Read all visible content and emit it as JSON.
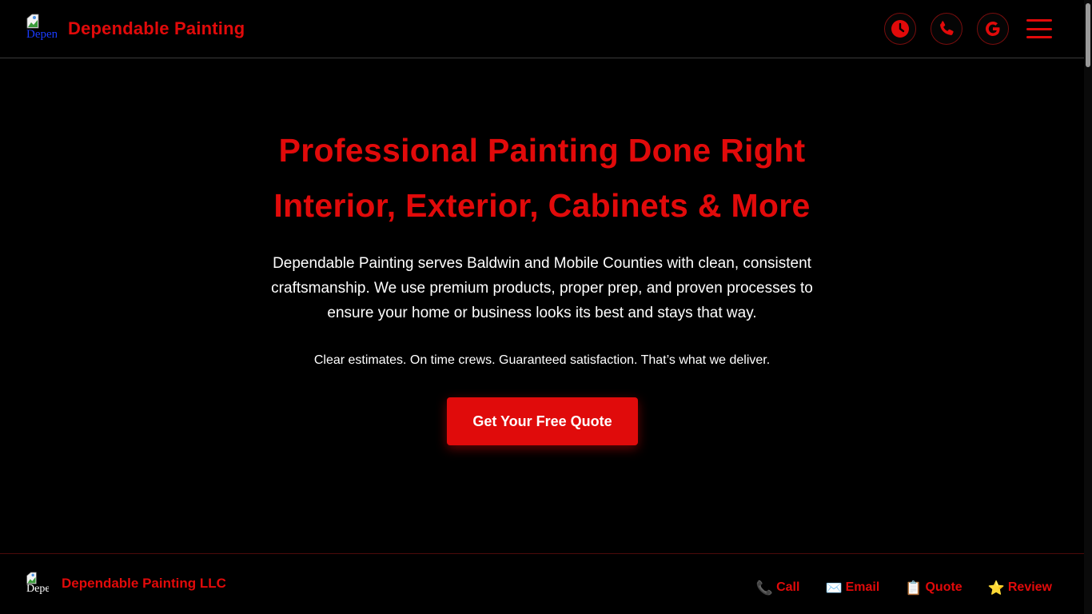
{
  "header": {
    "logo_alt": "Dependable Painting",
    "brand": "Dependable Painting",
    "buttons": [
      {
        "icon": "clock-icon"
      },
      {
        "icon": "phone-icon"
      },
      {
        "icon": "google-icon"
      }
    ],
    "menu_icon": "hamburger-menu-icon"
  },
  "hero": {
    "title_line1": "Professional Painting Done Right",
    "title_line2": "Interior, Exterior, Cabinets & More",
    "lead": "Dependable Painting serves Baldwin and Mobile Counties with clean, consistent craftsmanship. We use premium products, proper prep, and proven processes to ensure your home or business looks its best and stays that way.",
    "subtext": "Clear estimates. On time crews. Guaranteed satisfaction. That’s what we deliver.",
    "cta_label": "Get Your Free Quote"
  },
  "footer": {
    "logo_alt": "Dependable Painting LLC",
    "name": "Dependable Painting LLC",
    "links": [
      {
        "emoji": "📞",
        "label": "Call"
      },
      {
        "emoji": "✉️",
        "label": "Email"
      },
      {
        "emoji": "📋",
        "label": "Quote"
      },
      {
        "emoji": "⭐",
        "label": "Review"
      }
    ]
  },
  "colors": {
    "accent": "#e10a0a",
    "background": "#000000",
    "text": "#ffffff"
  }
}
